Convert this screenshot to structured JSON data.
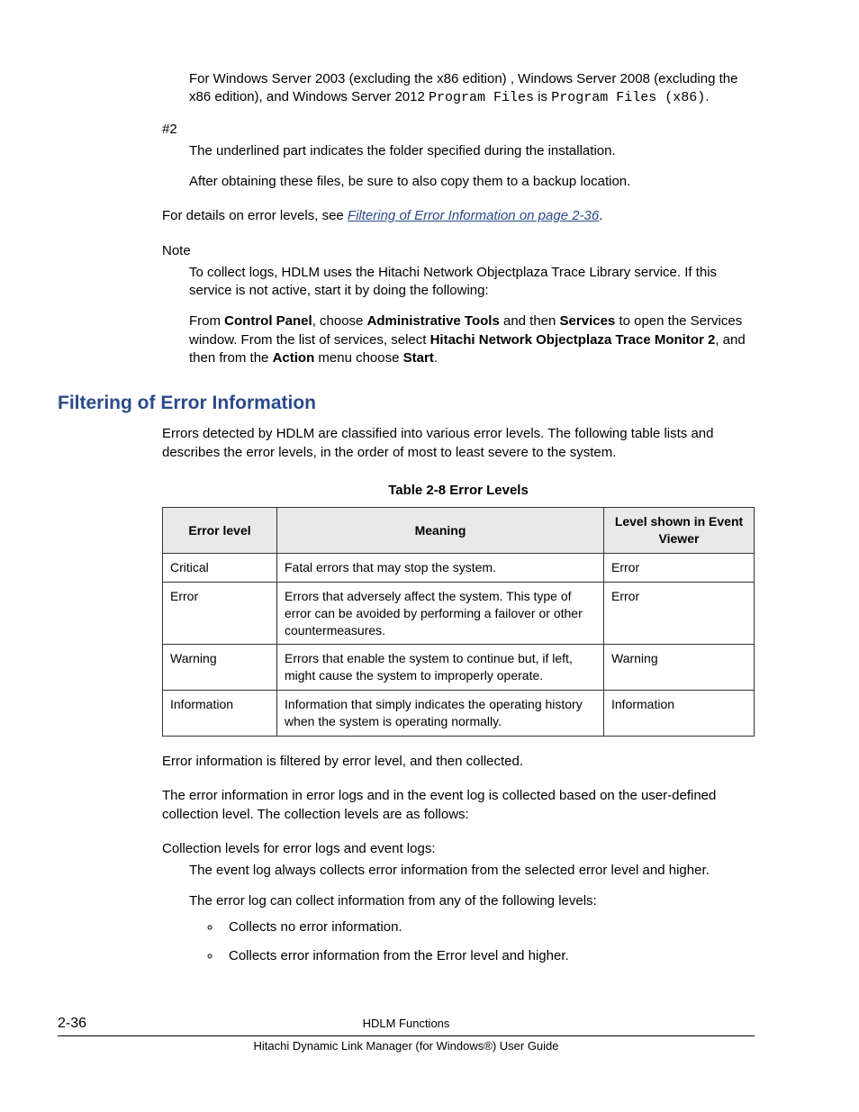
{
  "intro": {
    "p1_a": "For Windows Server 2003 (excluding the x86 edition) , Windows Server 2008 (excluding the x86 edition), and Windows Server 2012 ",
    "p1_code1": "Program Files",
    "p1_b": " is ",
    "p1_code2": "Program Files (x86)",
    "p1_c": "."
  },
  "note2": {
    "label": "#2",
    "p1": "The underlined part indicates the folder specified during the installation.",
    "p2": "After obtaining these files, be sure to also copy them to a backup location."
  },
  "link_line": {
    "pre": "For details on error levels, see ",
    "link": "Filtering of Error Information on page 2-36",
    "post": "."
  },
  "note": {
    "label": "Note",
    "p1": "To collect logs, HDLM uses the Hitachi Network Objectplaza Trace Library service. If this service is not active, start it by doing the following:",
    "p2_a": "From ",
    "p2_b": "Control Panel",
    "p2_c": ", choose ",
    "p2_d": "Administrative Tools",
    "p2_e": " and then ",
    "p2_f": "Services",
    "p2_g": " to open the Services window. From the list of services, select ",
    "p2_h": "Hitachi Network Objectplaza Trace Monitor 2",
    "p2_i": ", and then from the ",
    "p2_j": "Action",
    "p2_k": " menu choose ",
    "p2_l": "Start",
    "p2_m": "."
  },
  "section": {
    "title": "Filtering of Error Information",
    "p1": "Errors detected by HDLM are classified into various error levels. The following table lists and describes the error levels, in the order of most to least severe to the system."
  },
  "table": {
    "caption": "Table 2-8 Error Levels",
    "headers": [
      "Error level",
      "Meaning",
      "Level shown in Event Viewer"
    ],
    "rows": [
      [
        "Critical",
        "Fatal errors that may stop the system.",
        "Error"
      ],
      [
        "Error",
        "Errors that adversely affect the system. This type of error can be avoided by performing a failover or other countermeasures.",
        "Error"
      ],
      [
        "Warning",
        "Errors that enable the system to continue but, if left, might cause the system to improperly operate.",
        "Warning"
      ],
      [
        "Information",
        "Information that simply indicates the operating history when the system is operating normally.",
        "Information"
      ]
    ]
  },
  "after": {
    "p1": "Error information is filtered by error level, and then collected.",
    "p2": "The error information in error logs and in the event log is collected based on the user-defined collection level. The collection levels are as follows:",
    "p3": "Collection levels for error logs and event logs:",
    "p3a": "The event log always collects error information from the selected error level and higher.",
    "p3b": "The error log can collect information from any of the following levels:",
    "b1": "Collects no error information.",
    "b2": "Collects error information from the Error level and higher."
  },
  "footer": {
    "page": "2-36",
    "line1": "HDLM Functions",
    "line2": "Hitachi Dynamic Link Manager (for Windows®) User Guide"
  }
}
